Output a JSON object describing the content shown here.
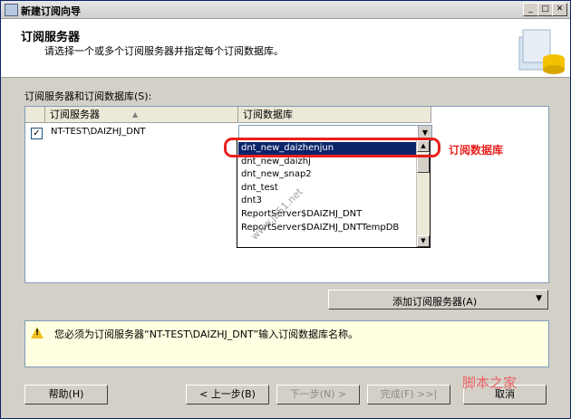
{
  "window": {
    "title": "新建订阅向导"
  },
  "header": {
    "title": "订阅服务器",
    "subtitle": "请选择一个或多个订阅服务器并指定每个订阅数据库。"
  },
  "grid": {
    "label": "订阅服务器和订阅数据库(S):",
    "col_server": "订阅服务器",
    "col_db": "订阅数据库",
    "row": {
      "server": "NT-TEST\\DAIZHJ_DNT",
      "checked": "✓"
    }
  },
  "dropdown": {
    "items": [
      "dnt_new_daizhenjun",
      "dnt_new_daizhj",
      "dnt_new_snap2",
      "dnt_test",
      "dnt3",
      "ReportServer$DAIZHJ_DNT",
      "ReportServer$DAIZHJ_DNTTempDB"
    ],
    "selected_index": 0
  },
  "annotation": {
    "label": "订阅数据库"
  },
  "watermark": {
    "text": "www.jb51.net"
  },
  "add_button": {
    "label": "添加订阅服务器(A)"
  },
  "message": {
    "text": "您必须为订阅服务器“NT-TEST\\DAIZHJ_DNT”输入订阅数据库名称。"
  },
  "buttons": {
    "help": "帮助(H)",
    "back": "< 上一步(B)",
    "next": "下一步(N) >",
    "finish": "完成(F) >>|",
    "cancel": "取消"
  },
  "credit": {
    "text": "脚本之家"
  }
}
